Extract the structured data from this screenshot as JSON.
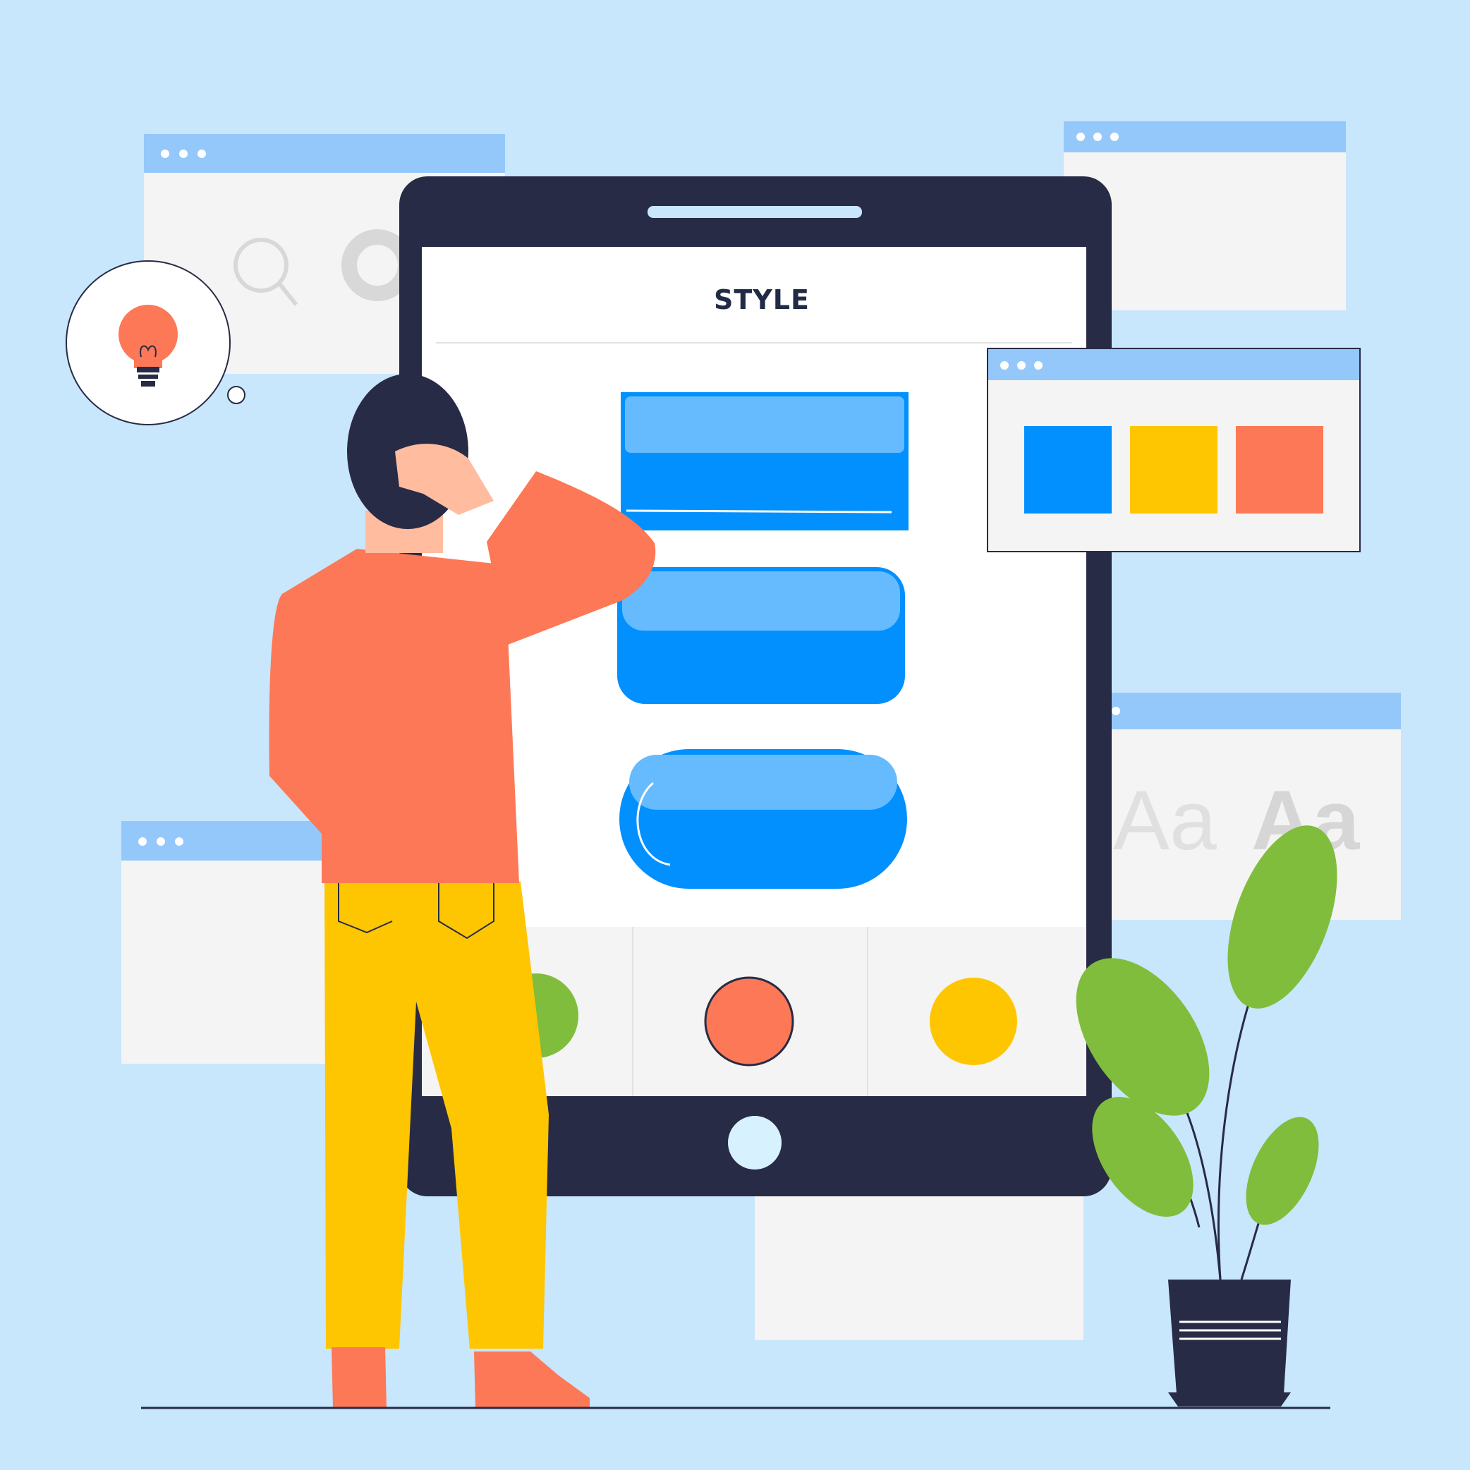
{
  "app": {
    "title": "STYLE"
  },
  "font_panel": {
    "sample_light": "Aa",
    "sample_bold": "Aa"
  },
  "colors": {
    "background": "#c8e6fc",
    "device_frame": "#272b45",
    "screen": "#ffffff",
    "button_blue": "#0290ff",
    "button_highlight": "#66bbff",
    "swatch_blue": "#0290ff",
    "swatch_yellow": "#fec601",
    "swatch_orange": "#fd7856",
    "window_bar": "#95c8fa",
    "window_body": "#f4f4f4",
    "shirt": "#fd7856",
    "pants": "#fec601",
    "hair": "#272b45",
    "leaf": "#80bd3c"
  },
  "icons": {
    "search": "search-icon",
    "bulb": "lightbulb-icon"
  }
}
